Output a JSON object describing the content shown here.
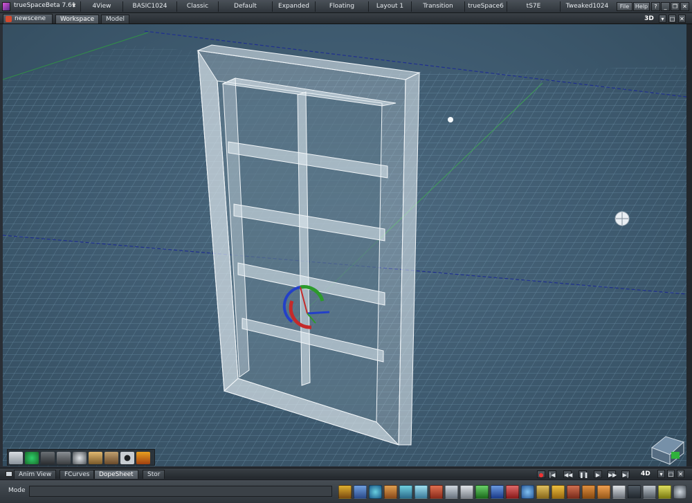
{
  "app": {
    "title": "trueSpaceBeta 7.61"
  },
  "layouts": [
    {
      "label": "4View"
    },
    {
      "label": "BASIC1024"
    },
    {
      "label": "Classic"
    },
    {
      "label": "Default"
    },
    {
      "label": "Expanded"
    },
    {
      "label": "Floating"
    },
    {
      "label": "Layout 1"
    },
    {
      "label": "Transition"
    },
    {
      "label": "trueSpace6"
    },
    {
      "label": "tS7E"
    },
    {
      "label": "Tweaked1024"
    }
  ],
  "top_buttons": {
    "file": "File",
    "help": "Help"
  },
  "scene_tab": {
    "label": "newscene"
  },
  "view_tabs": [
    {
      "label": "Workspace",
      "active": true
    },
    {
      "label": "Model",
      "active": false
    }
  ],
  "view_mode": "3D",
  "panel_tabs": [
    {
      "label": "Anim View",
      "active": false
    },
    {
      "label": "FCurves",
      "active": false
    },
    {
      "label": "DopeSheet",
      "active": true
    },
    {
      "label": "Stor",
      "active": false
    }
  ],
  "anim_mode": "4D",
  "status": {
    "label": "Mode",
    "value": ""
  },
  "icons": {
    "viewport_tools": [
      "select-arrow-icon",
      "sphere-primitive-icon",
      "cube-primitive-icon",
      "cylinder-primitive-icon",
      "paint-icon",
      "light-icon",
      "brush-icon",
      "torus-icon",
      "knife-icon"
    ],
    "main_tools": [
      "link-icon",
      "paint-icon",
      "rotate-icon",
      "snap-icon",
      "scene-icon",
      "library-icon",
      "object-tool-icon",
      "move-icon",
      "widget-icon",
      "axis-x-icon",
      "axis-y-icon",
      "axis-z-icon",
      "rotate-tool-icon",
      "scale-tool-icon",
      "camera-icon",
      "home-icon",
      "grid-icon",
      "light-tool-icon",
      "primitive-icon",
      "camera-view-icon",
      "material-icon",
      "screen-icon",
      "render-icon",
      "render-scene-icon"
    ]
  },
  "colors": {
    "viewport_bg": "#3e5a6f",
    "grid": "#6f8ea3",
    "axis_x": "#1f2f8f",
    "axis_z": "#2f9f3f",
    "selection": "#e9eef3"
  }
}
